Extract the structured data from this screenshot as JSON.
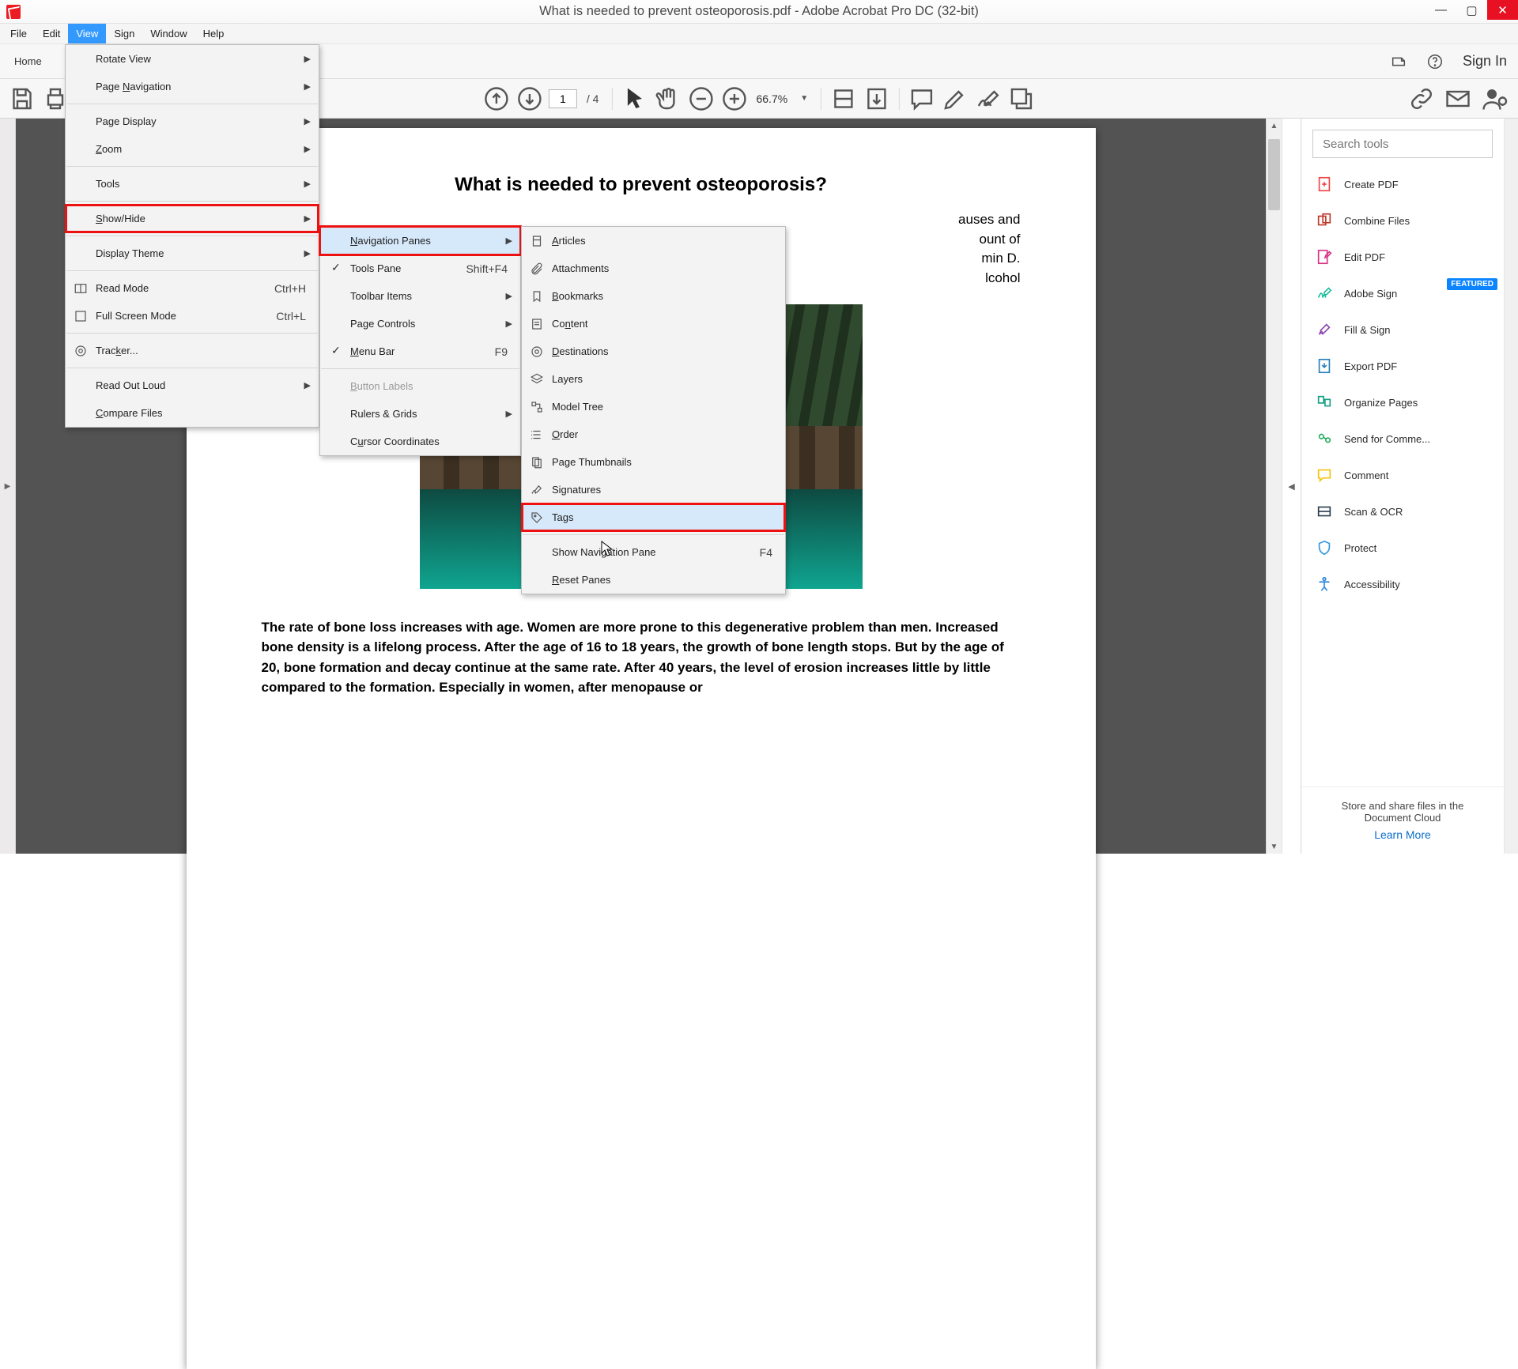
{
  "window": {
    "title": "What is needed to prevent osteoporosis.pdf - Adobe Acrobat Pro DC (32-bit)"
  },
  "menubar": [
    "File",
    "Edit",
    "View",
    "Sign",
    "Window",
    "Help"
  ],
  "tabs": {
    "home": "Home",
    "signin": "Sign In"
  },
  "toolbar": {
    "page_current": "1",
    "page_total": "/ 4",
    "zoom": "66.7%"
  },
  "menus": {
    "view": {
      "rotate": "Rotate View",
      "pagenav": "Page Navigation",
      "pagedisplay": "Page Display",
      "zoom": "Zoom",
      "tools": "Tools",
      "showhide": "Show/Hide",
      "displaytheme": "Display Theme",
      "readmode": "Read Mode",
      "readmode_accel": "Ctrl+H",
      "fullscreen": "Full Screen Mode",
      "fullscreen_accel": "Ctrl+L",
      "tracker": "Tracker...",
      "readoutloud": "Read Out Loud",
      "compare": "Compare Files"
    },
    "showhide": {
      "navpanes": "Navigation Panes",
      "toolspane": "Tools Pane",
      "toolspane_accel": "Shift+F4",
      "toolbaritems": "Toolbar Items",
      "pagecontrols": "Page Controls",
      "menubar": "Menu Bar",
      "menubar_accel": "F9",
      "buttonlabels": "Button Labels",
      "rulers": "Rulers & Grids",
      "cursor": "Cursor Coordinates"
    },
    "navpanes": {
      "articles": "Articles",
      "attachments": "Attachments",
      "bookmarks": "Bookmarks",
      "content": "Content",
      "destinations": "Destinations",
      "layers": "Layers",
      "modeltree": "Model Tree",
      "order": "Order",
      "pagethumbs": "Page Thumbnails",
      "signatures": "Signatures",
      "tags": "Tags",
      "shownav": "Show Navigation Pane",
      "shownav_accel": "F4",
      "reset": "Reset Panes"
    }
  },
  "rpanel": {
    "search_placeholder": "Search tools",
    "items": [
      "Create PDF",
      "Combine Files",
      "Edit PDF",
      "Adobe Sign",
      "Fill & Sign",
      "Export PDF",
      "Organize Pages",
      "Send for Comme...",
      "Comment",
      "Scan & OCR",
      "Protect",
      "Accessibility"
    ],
    "featured": "FEATURED",
    "footer": "Store and share files in the Document Cloud",
    "learn": "Learn More"
  },
  "document": {
    "heading": "What is needed to prevent osteoporosis?",
    "intro": "auses and\nount of\nmin D.\nlcohol",
    "body": "The rate of bone loss increases with age. Women are more prone to this degenerative problem than men. Increased bone density is a lifelong process. After the age of 16 to 18 years, the growth of bone length stops. But by the age of 20, bone formation and decay continue at the same rate. After 40 years, the level of erosion increases little by little compared to the formation. Especially in women, after menopause or"
  }
}
